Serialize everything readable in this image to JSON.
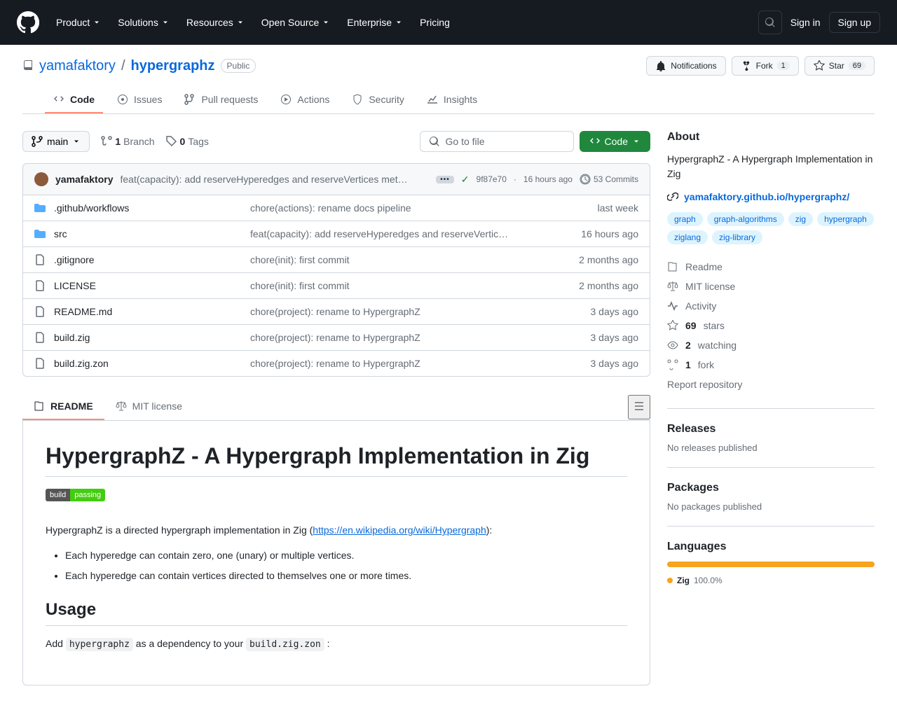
{
  "header": {
    "nav": [
      "Product",
      "Solutions",
      "Resources",
      "Open Source",
      "Enterprise",
      "Pricing"
    ],
    "signin": "Sign in",
    "signup": "Sign up"
  },
  "repo": {
    "owner": "yamafaktory",
    "name": "hypergraphz",
    "visibility": "Public",
    "notifications": "Notifications",
    "fork": "Fork",
    "fork_count": "1",
    "star": "Star",
    "star_count": "69"
  },
  "tabs": [
    {
      "label": "Code"
    },
    {
      "label": "Issues"
    },
    {
      "label": "Pull requests"
    },
    {
      "label": "Actions"
    },
    {
      "label": "Security"
    },
    {
      "label": "Insights"
    }
  ],
  "branch": {
    "name": "main",
    "branches_count": "1",
    "branches_label": "Branch",
    "tags_count": "0",
    "tags_label": "Tags",
    "goto": "Go to file",
    "code_btn": "Code"
  },
  "latest_commit": {
    "author": "yamafaktory",
    "message": "feat(capacity): add reserveHyperedges and reserveVertices met…",
    "sha": "9f87e70",
    "time": "16 hours ago",
    "commits_count": "53 Commits"
  },
  "files": [
    {
      "type": "dir",
      "name": ".github/workflows",
      "msg": "chore(actions): rename docs pipeline",
      "date": "last week"
    },
    {
      "type": "dir",
      "name": "src",
      "msg": "feat(capacity): add reserveHyperedges and reserveVertic…",
      "date": "16 hours ago"
    },
    {
      "type": "file",
      "name": ".gitignore",
      "msg": "chore(init): first commit",
      "date": "2 months ago"
    },
    {
      "type": "file",
      "name": "LICENSE",
      "msg": "chore(init): first commit",
      "date": "2 months ago"
    },
    {
      "type": "file",
      "name": "README.md",
      "msg": "chore(project): rename to HypergraphZ",
      "date": "3 days ago"
    },
    {
      "type": "file",
      "name": "build.zig",
      "msg": "chore(project): rename to HypergraphZ",
      "date": "3 days ago"
    },
    {
      "type": "file",
      "name": "build.zig.zon",
      "msg": "chore(project): rename to HypergraphZ",
      "date": "3 days ago"
    }
  ],
  "readme_nav": {
    "readme": "README",
    "license": "MIT license"
  },
  "readme": {
    "title": "HypergraphZ - A Hypergraph Implementation in Zig",
    "badge_l": "build",
    "badge_r": "passing",
    "intro_pre": "HypergraphZ is a directed hypergraph implementation in Zig (",
    "intro_link": "https://en.wikipedia.org/wiki/Hypergraph",
    "intro_post": "):",
    "bullets": [
      "Each hyperedge can contain zero, one (unary) or multiple vertices.",
      "Each hyperedge can contain vertices directed to themselves one or more times."
    ],
    "usage_h": "Usage",
    "usage_p_pre": "Add ",
    "usage_code1": "hypergraphz",
    "usage_p_mid": " as a dependency to your ",
    "usage_code2": "build.zig.zon",
    "usage_p_post": " :"
  },
  "about": {
    "heading": "About",
    "description": "HypergraphZ - A Hypergraph Implementation in Zig",
    "link": "yamafaktory.github.io/hypergraphz/",
    "topics": [
      "graph",
      "graph-algorithms",
      "zig",
      "hypergraph",
      "ziglang",
      "zig-library"
    ],
    "meta": {
      "readme": "Readme",
      "license": "MIT license",
      "activity": "Activity",
      "stars_n": "69",
      "stars_l": "stars",
      "watch_n": "2",
      "watch_l": "watching",
      "fork_n": "1",
      "fork_l": "fork",
      "report": "Report repository"
    }
  },
  "releases": {
    "heading": "Releases",
    "text": "No releases published"
  },
  "packages": {
    "heading": "Packages",
    "text": "No packages published"
  },
  "languages": {
    "heading": "Languages",
    "lang": "Zig",
    "pct": "100.0%"
  }
}
